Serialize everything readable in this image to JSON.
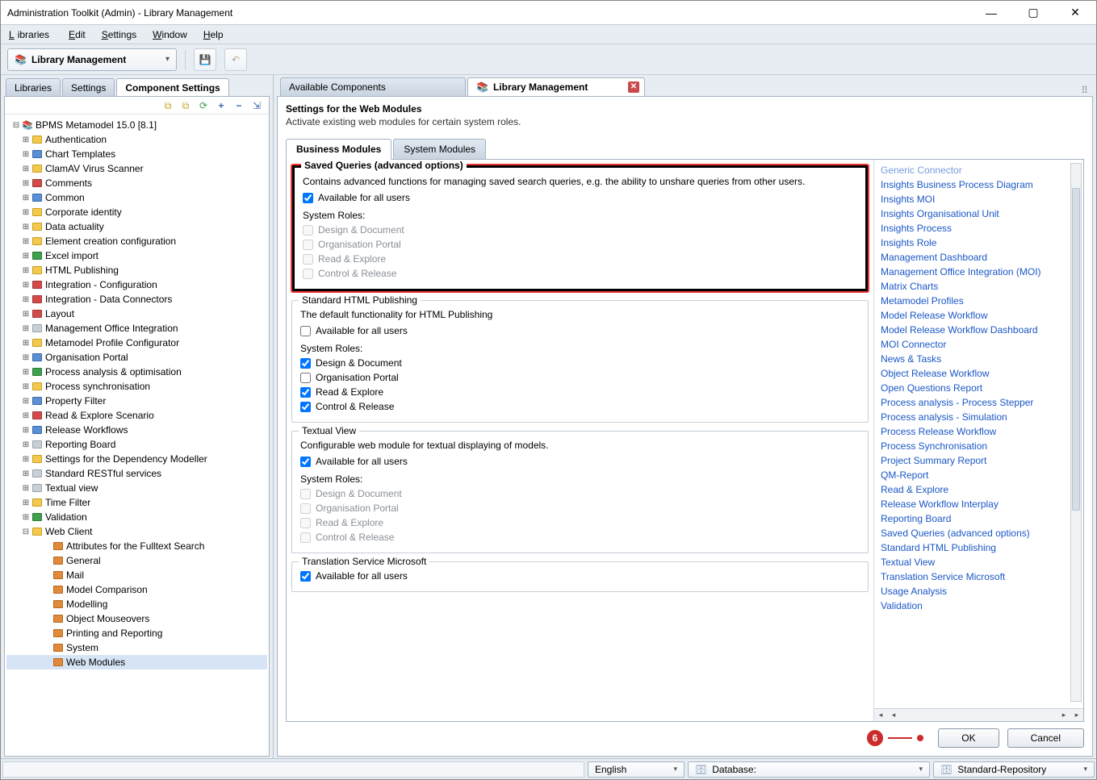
{
  "window": {
    "title": "Administration Toolkit (Admin) - Library Management"
  },
  "menu": {
    "libraries": "Libraries",
    "edit": "Edit",
    "settings": "Settings",
    "window": "Window",
    "help": "Help"
  },
  "toolbar": {
    "dropdown": "Library Management"
  },
  "left_tabs": {
    "libraries": "Libraries",
    "settings": "Settings",
    "component": "Component Settings"
  },
  "tree": {
    "root": "BPMS Metamodel 15.0 [8.1]",
    "nodes": [
      "Authentication",
      "Chart Templates",
      "ClamAV Virus Scanner",
      "Comments",
      "Common",
      "Corporate identity",
      "Data actuality",
      "Element creation configuration",
      "Excel import",
      "HTML Publishing",
      "Integration - Configuration",
      "Integration - Data Connectors",
      "Layout",
      "Management Office Integration",
      "Metamodel Profile Configurator",
      "Organisation Portal",
      "Process analysis & optimisation",
      "Process synchronisation",
      "Property Filter",
      "Read & Explore Scenario",
      "Release Workflows",
      "Reporting Board",
      "Settings for the Dependency Modeller",
      "Standard RESTful services",
      "Textual view",
      "Time Filter",
      "Validation",
      "Web Client"
    ],
    "web_client_children": [
      "Attributes for the Fulltext Search",
      "General",
      "Mail",
      "Model Comparison",
      "Modelling",
      "Object Mouseovers",
      "Printing and Reporting",
      "System",
      "Web Modules"
    ]
  },
  "right_tabs": {
    "available": "Available Components",
    "libmgmt": "Library Management"
  },
  "settings": {
    "heading": "Settings for the Web Modules",
    "sub": "Activate existing web modules for certain system roles."
  },
  "inner_tabs": {
    "business": "Business Modules",
    "system": "System Modules"
  },
  "common": {
    "system_roles": "System Roles:",
    "avail_all": "Available for all users",
    "role_dd": "Design & Document",
    "role_op": "Organisation Portal",
    "role_re": "Read & Explore",
    "role_cr": "Control & Release"
  },
  "modules": {
    "saved": {
      "title": "Saved Queries (advanced options)",
      "desc": "Contains advanced functions for managing saved search queries, e.g. the ability to unshare queries from other users."
    },
    "html": {
      "title": "Standard HTML Publishing",
      "desc": "The default functionality for HTML Publishing"
    },
    "textual": {
      "title": "Textual View",
      "desc": "Configurable web module for textual displaying of models."
    },
    "trans": {
      "title": "Translation Service Microsoft"
    }
  },
  "links": [
    "Generic Connector",
    "Insights Business Process Diagram",
    "Insights MOI",
    "Insights Organisational Unit",
    "Insights Process",
    "Insights Role",
    "Management Dashboard",
    "Management Office Integration (MOI)",
    "Matrix Charts",
    "Metamodel Profiles",
    "Model Release Workflow",
    "Model Release Workflow Dashboard",
    "MOI Connector",
    "News & Tasks",
    "Object Release Workflow",
    "Open Questions Report",
    "Process analysis - Process Stepper",
    "Process analysis - Simulation",
    "Process Release Workflow",
    "Process Synchronisation",
    "Project Summary Report",
    "QM-Report",
    "Read & Explore",
    "Release Workflow Interplay",
    "Reporting Board",
    "Saved Queries (advanced options)",
    "Standard HTML Publishing",
    "Textual View",
    "Translation Service Microsoft",
    "Usage Analysis",
    "Validation"
  ],
  "buttons": {
    "ok": "OK",
    "cancel": "Cancel"
  },
  "annotation": {
    "num": "6"
  },
  "status": {
    "lang": "English",
    "db": "Database:",
    "repo": "Standard-Repository"
  }
}
